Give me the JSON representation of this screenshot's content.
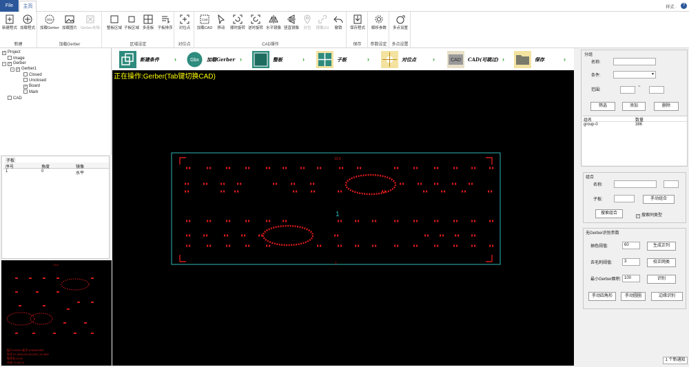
{
  "tabs": {
    "file": "File",
    "home": "主页"
  },
  "window": {
    "style": "样式 ·",
    "help": "?"
  },
  "ribbon": {
    "groups": [
      {
        "label": "新建",
        "buttons": [
          "新建程式",
          "加载程式"
        ]
      },
      {
        "label": "加载Gerber",
        "buttons": [
          "加载Gerber",
          "加载图片",
          "Gerber去除"
        ]
      },
      {
        "label": "区域设定",
        "buttons": [
          "整板区域",
          "子板区域",
          "多连板",
          "子板排序"
        ]
      },
      {
        "label": "对位点",
        "buttons": [
          "对位点"
        ]
      },
      {
        "label": "CAD操作",
        "buttons": [
          "加载CAD",
          "移动",
          "顺时旋转",
          "逆时旋转",
          "水平镜像",
          "竖直镜像",
          "对位",
          "镜像(G)",
          "撤销"
        ]
      },
      {
        "label": "保存",
        "buttons": [
          "保存程式"
        ]
      },
      {
        "label": "参数设定",
        "buttons": [
          "解析参数"
        ]
      },
      {
        "label": "多点设置",
        "buttons": [
          "多点设置"
        ]
      }
    ]
  },
  "tree": {
    "project": "Project",
    "image": "Image",
    "gerber": "Gerber",
    "gerber1": "Gerber1",
    "closed": "Closed",
    "unclosed": "Unclosed",
    "board": "Board",
    "mark": "Mark",
    "cad": "CAD"
  },
  "subboard": {
    "title": "子板",
    "headers": [
      "序号",
      "角度",
      "镜像"
    ],
    "rows": [
      [
        "1",
        "0",
        "水平"
      ]
    ]
  },
  "steps": [
    "新建条件",
    "加载Gerber",
    "整板",
    "子板",
    "对位点",
    "CAD(可跳过)",
    "保存"
  ],
  "canvas": {
    "op_text": "正在操作:Gerber(Tab键切换CAD)",
    "marker": "1",
    "top_label": "13.6"
  },
  "mini": {
    "info": [
      "板尺:HOHO  板号:1234567890",
      "型号:47-4000-30-023-022_01-B00",
      "程序名:11.63",
      "作成:72.547%"
    ]
  },
  "group_panel": {
    "title": "分组",
    "name_label": "名称:",
    "cond_label": "条件:",
    "range_label": "范围:",
    "range_sep": "~",
    "filter": "筛选",
    "add": "添加",
    "delete": "删除",
    "headers": [
      "组名",
      "数量"
    ],
    "rows": [
      [
        "group-0",
        "386"
      ]
    ]
  },
  "combine_panel": {
    "title": "组合",
    "name_label": "名称:",
    "subboard_label": "子板:",
    "manual": "手动组合",
    "search": "搜索组合",
    "same_type": "搜索同类型",
    "same_checked": true
  },
  "nogerber_panel": {
    "title": "无Gerber识别参数",
    "threshold_label": "抽色阈值:",
    "threshold": "60",
    "gen": "生成正列",
    "burr_label": "去毛刺阈值:",
    "burr": "3",
    "correct": "校正网类",
    "area_label": "最小Gerber面积:",
    "area": "100",
    "recognize": "识别",
    "manual_rect": "手动四角形",
    "manual_circle": "手动圆圈",
    "edge": "边缘识别"
  },
  "status": {
    "text": "1 个新通知"
  },
  "colors": {
    "accent": "#2b579a",
    "pad": "#d61a1a",
    "outline": "#2fb8b8",
    "op_text": "#ffff00",
    "step_icon": "#2e8b7d"
  }
}
